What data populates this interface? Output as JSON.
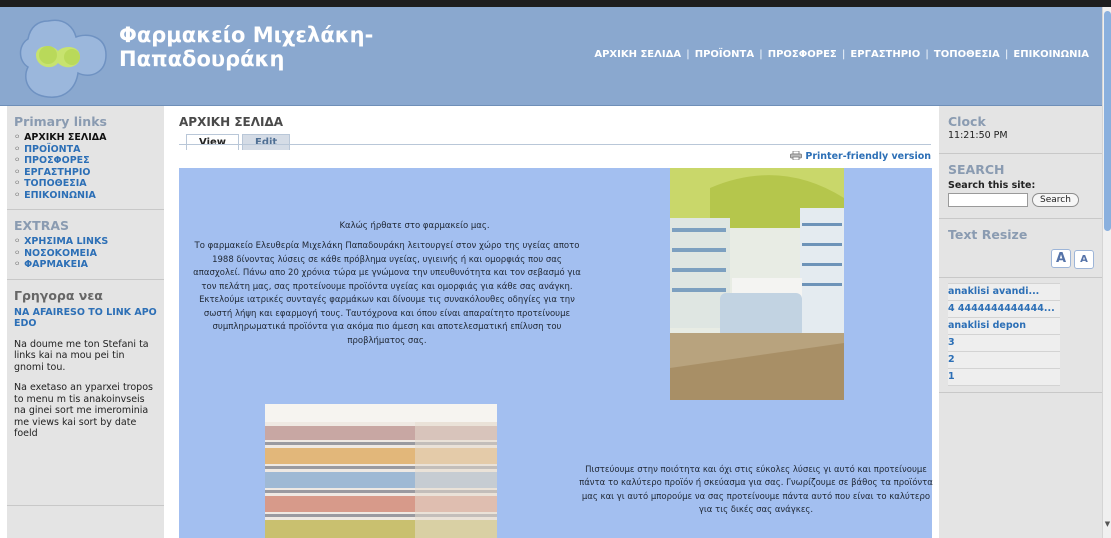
{
  "header": {
    "site_name_line1": "Φαρμακείο Μιχελάκη-",
    "site_name_line2": "Παπαδουράκη",
    "nav": [
      "ΑΡΧΙΚΗ ΣΕΛΙΔΑ",
      "ΠΡΟΪΟΝΤΑ",
      "ΠΡΟΣΦΟΡΕΣ",
      "ΕΡΓΑΣΤΗΡΙΟ",
      "ΤΟΠΟΘΕΣΙΑ",
      "ΕΠΙΚΟΙΝΩΝΙΑ"
    ],
    "nav_separator": "|"
  },
  "sidebar_left": {
    "primary_title": "Primary links",
    "primary_links": [
      "ΑΡΧΙΚΗ ΣΕΛΙΔΑ",
      "ΠΡΟΪΟΝΤΑ",
      "ΠΡΟΣΦΟΡΕΣ",
      "ΕΡΓΑΣΤΗΡΙΟ",
      "ΤΟΠΟΘΕΣΙΑ",
      "ΕΠΙΚΟΙΝΩΝΙΑ"
    ],
    "extras_title": "EXTRAS",
    "extras_links": [
      "ΧΡΗΣΙΜΑ LINKS",
      "ΝΟΣΟΚΟΜΕΙΑ",
      "ΦΑΡΜΑΚΕΙΑ"
    ],
    "news_title": "Γρηγορα νεα",
    "news_link": "NA AFAIRESO TO LINK APO EDO",
    "news_text1": "Na doume me ton Stefani ta links kai na mou pei tin gnomi tou.",
    "news_text2": "Na exetaso an yparxei tropos to menu m tis anakoinvseis na ginei sort me imerominia me views kai sort by date foeld"
  },
  "main": {
    "title": "ΑΡΧΙΚΗ ΣΕΛΙΔΑ",
    "tab_view": "View",
    "tab_edit": "Edit",
    "printer_link": "Printer-friendly version",
    "welcome": "Καλώς ήρθατε στο φαρμακείο μας.",
    "intro": "Το φαρμακείο Ελευθερία Μιχελάκη Παπαδουράκη λειτουργεί στον χώρο της υγείας αποτο 1988 δίνοντας λύσεις σε κάθε πρόβλημα υγείας, υγιεινής ή και ομορφιάς που σας απασχολεί. Πάνω απο 20 χρόνια τώρα με γνώμονα την υπευθυνότητα και τον σεβασμό για τον πελάτη μας, σας προτείνουμε προϊόντα υγείας και ομορφιάς για κάθε σας ανάγκη. Εκτελούμε ιατρικές συνταγές φαρμάκων και δίνουμε τις συνακόλουθες οδηγίες για την σωστή λήψη και εφαρμογή τους. Ταυτόχρονα και όπου είναι απαραίτητο προτείνουμε συμπληρωματικά προϊόντα για ακόμα πιο άμεση και αποτελεσματική επίλυση του προβλήματος σας.",
    "closing": "Πιστεύουμε στην ποιότητα και όχι στις εύκολες λύσεις γι αυτό και προτείνουμε πάντα το καλύτερο προϊόν ή σκεύασμα για σας. Γνωρίζουμε σε βάθος τα προϊόντα μας και γι αυτό μπορούμε να σας προτείνουμε πάντα αυτό που είναι το καλύτερο για τις δικές σας ανάγκες."
  },
  "sidebar_right": {
    "clock_title": "Clock",
    "clock_time": "11:21:50 PM",
    "search_title": "SEARCH",
    "search_label": "Search this site:",
    "search_value": "",
    "search_button": "Search",
    "resize_title": "Text Resize",
    "resize_big": "A",
    "resize_small": "A",
    "views_list": [
      "anaklisi avandi...",
      "4 4444444444444...",
      "anaklisi depon",
      "3",
      "2",
      "1"
    ]
  },
  "icons": [
    "logo-icon",
    "printer-icon",
    "text-resize-increase-icon",
    "text-resize-decrease-icon"
  ],
  "colors": {
    "header_bg": "#8aa8cf",
    "content_bg": "#a3bff0",
    "sidebar_bg": "#e4e4e4",
    "link": "#2c6fb6"
  }
}
